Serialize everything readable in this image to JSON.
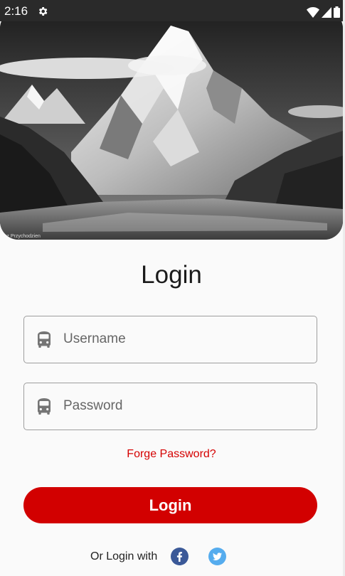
{
  "status_bar": {
    "time": "2:16",
    "icons": [
      "settings-gear-icon",
      "wifi-icon",
      "cellular-signal-icon",
      "battery-icon"
    ]
  },
  "hero": {
    "image": "snow-capped-mountain-black-and-white",
    "credit": "asz Przychodzien"
  },
  "title": "Login",
  "username": {
    "placeholder": "Username",
    "value": "",
    "icon": "bus-icon"
  },
  "password": {
    "placeholder": "Password",
    "value": "",
    "icon": "bus-icon"
  },
  "forgot_link": "Forge Password?",
  "login_button": "Login",
  "social": {
    "label": "Or Login with",
    "icons": [
      "facebook-icon",
      "twitter-icon"
    ]
  },
  "colors": {
    "accent": "#d20000",
    "forgot_link": "#d50000",
    "facebook": "#3b5998",
    "twitter": "#55acee",
    "status_bar": "#2a2a2a"
  }
}
